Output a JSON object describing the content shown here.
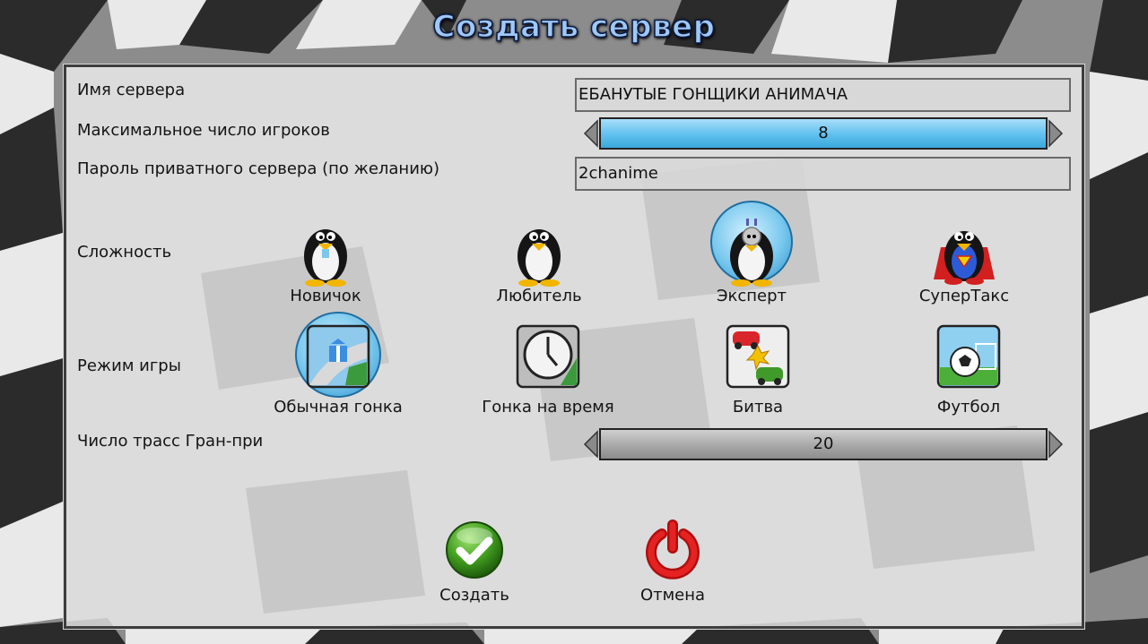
{
  "title": "Создать сервер",
  "fields": {
    "server_name_label": "Имя сервера",
    "server_name_value": "ЕБАНУТЫЕ ГОНЩИКИ АНИМАЧА",
    "max_players_label": "Максимальное число игроков",
    "max_players_value": "8",
    "password_label": "Пароль приватного сервера (по желанию)",
    "password_value": "2chanime",
    "gp_tracks_label": "Число трасс Гран-при",
    "gp_tracks_value": "20"
  },
  "difficulty": {
    "label": "Сложность",
    "options": [
      "Новичок",
      "Любитель",
      "Эксперт",
      "СуперТакс"
    ],
    "selected": "Эксперт"
  },
  "game_mode": {
    "label": "Режим игры",
    "options": [
      "Обычная гонка",
      "Гонка на время",
      "Битва",
      "Футбол"
    ],
    "selected": "Обычная гонка"
  },
  "buttons": {
    "create_label": "Создать",
    "cancel_label": "Отмена"
  },
  "colors": {
    "accent": "#5fc0ee",
    "create": "#3f9a1e",
    "cancel": "#c81a1a"
  }
}
